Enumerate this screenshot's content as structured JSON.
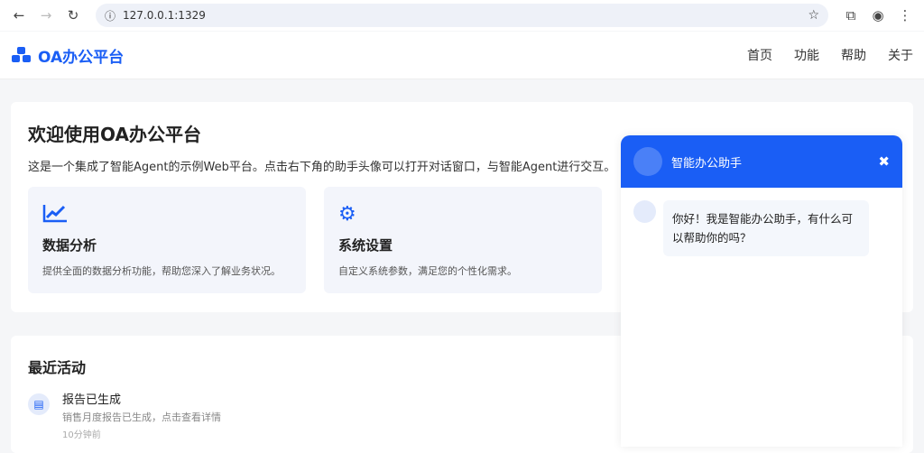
{
  "browser": {
    "url": "127.0.0.1:1329"
  },
  "header": {
    "logo": "OA办公平台",
    "nav": [
      "首页",
      "功能",
      "帮助",
      "关于"
    ]
  },
  "welcome": {
    "title": "欢迎使用OA办公平台",
    "desc": "这是一个集成了智能Agent的示例Web平台。点击右下角的助手头像可以打开对话窗口，与智能Agent进行交互。",
    "features": [
      {
        "title": "数据分析",
        "desc": "提供全面的数据分析功能，帮助您深入了解业务状况。"
      },
      {
        "title": "系统设置",
        "desc": "自定义系统参数，满足您的个性化需求。"
      }
    ]
  },
  "activity": {
    "title": "最近活动",
    "items": [
      {
        "title": "报告已生成",
        "desc": "销售月度报告已生成，点击查看详情",
        "time": "10分钟前"
      }
    ]
  },
  "chat": {
    "title": "智能办公助手",
    "close": "✖",
    "messages": [
      {
        "from": "assistant",
        "text": "你好！我是智能办公助手，有什么可以帮助你的吗？"
      }
    ]
  }
}
